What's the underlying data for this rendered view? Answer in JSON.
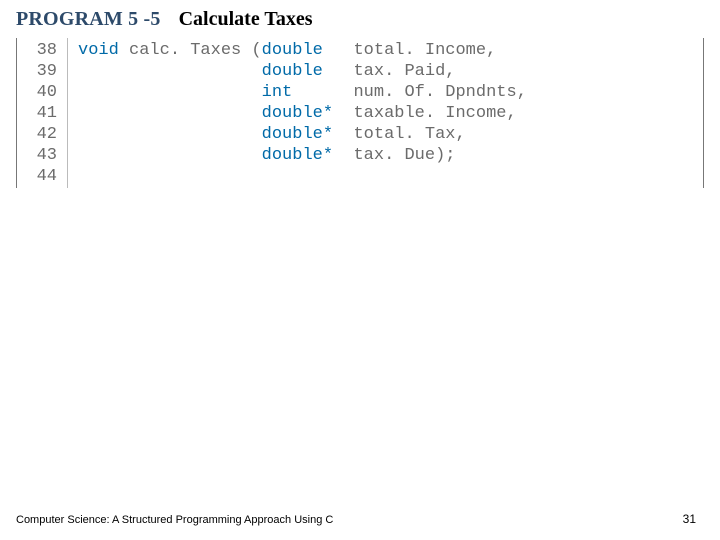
{
  "header": {
    "program_label": "PROGRAM 5 -5",
    "program_title": "Calculate Taxes"
  },
  "code": {
    "line_numbers": [
      "38",
      "39",
      "40",
      "41",
      "42",
      "43",
      "44"
    ],
    "tokens": {
      "kw_void": "void",
      "fn_name": "calc. Taxes",
      "open_paren": " (",
      "type_double": "double",
      "type_int": "int",
      "type_double_ptr": "double*",
      "p1": "total. Income,",
      "p2": "tax. Paid,",
      "p3": "num. Of. Dpndnts,",
      "p4": "taxable. Income,",
      "p5": "total. Tax,",
      "p6": "tax. Due);"
    }
  },
  "footer": {
    "book_title": "Computer Science: A Structured Programming Approach Using C",
    "page_number": "31"
  }
}
